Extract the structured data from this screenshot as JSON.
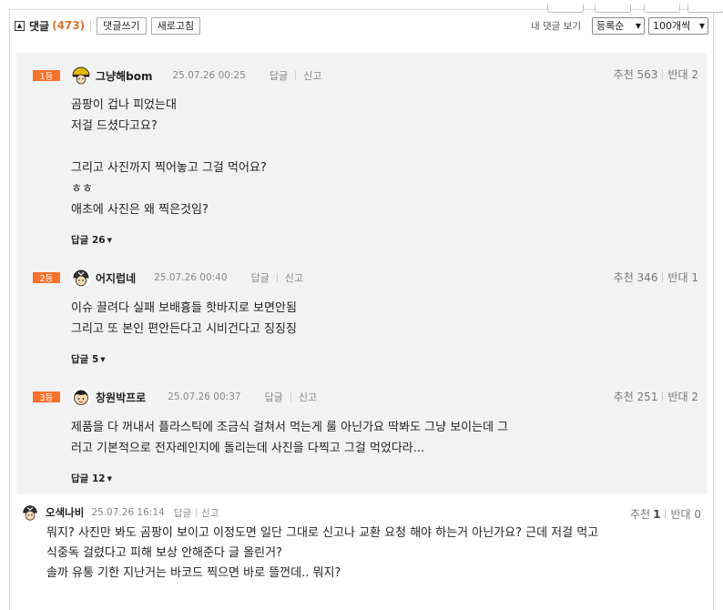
{
  "toolbar": {
    "title": "댓글",
    "count": "(473)",
    "write_button": "댓글쓰기",
    "refresh_button": "새로고침",
    "my_comments_link": "내 댓글 보기",
    "sort_select": "등록순",
    "per_page_select": "100개씩"
  },
  "comments": [
    {
      "rank": "1등",
      "nickname": "그냥해bom",
      "datetime": "25.07.26 00:25",
      "reply": "답글",
      "report": "신고",
      "recommend": "추천 563",
      "oppose": "반대 2",
      "body": "곰팡이 겁나 피었는대\n저걸 드셨다고요?\n\n그리고 사진까지 찍어놓고 그걸 먹어요?\nㅎㅎ\n애초에 사진은 왜 찍은것임?",
      "replies": "답글 26"
    },
    {
      "rank": "2등",
      "nickname": "어지럽네",
      "datetime": "25.07.26 00:40",
      "reply": "답글",
      "report": "신고",
      "recommend": "추천 346",
      "oppose": "반대 1",
      "body": "이슈 끌려다 실패 보배흉들 핫바지로 보면안됨\n그리고 또 본인 편안든다고 시비건다고 징징징",
      "replies": "답글 5"
    },
    {
      "rank": "3등",
      "nickname": "창원박프로",
      "datetime": "25.07.26 00:37",
      "reply": "답글",
      "report": "신고",
      "recommend": "추천 251",
      "oppose": "반대 2",
      "body": "제품을 다 꺼내서 플라스틱에 조금식 걸쳐서 먹는게 룰 아닌가요 딱봐도 그냥 보이는데 그\n러고 기본적으로 전자레인지에 돌리는데 사진을 다찍고 그걸 먹었다라...",
      "replies": "답글 12"
    },
    {
      "nickname": "오색나비",
      "datetime": "25.07.26 16:14",
      "reply": "답글",
      "report": "신고",
      "recommend_label": "추천",
      "recommend_count": "1",
      "oppose": "반대 0",
      "body": "뭐지? 사진만 봐도 곰팡이 보이고 이정도면 일단 그대로 신고나 교환 요청 해야 하는거 아닌가요? 근데 저걸 먹고\n식중독 걸렸다고 피해 보상 안해준다 글 올린거?\n솔까 유통 기한 지난거는 바코드 찍으면 바로 뜰껀데.. 뭐지?"
    }
  ],
  "colors": {
    "rank_badge": "#f4722b",
    "count_accent": "#e0712f",
    "best_bg": "#f2f2f2"
  }
}
